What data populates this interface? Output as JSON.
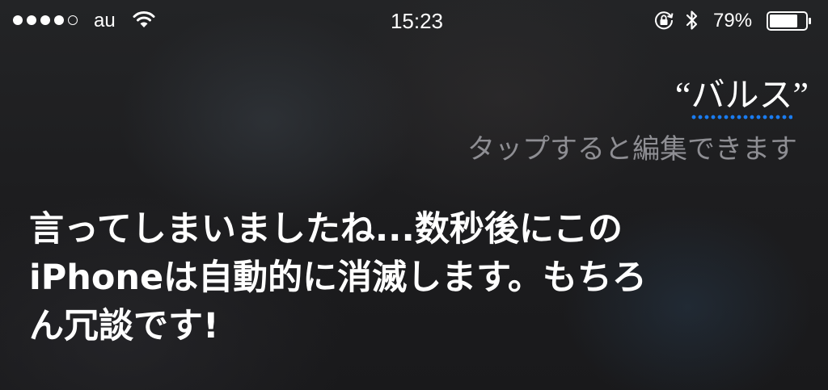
{
  "status_bar": {
    "signal_bars_filled": 4,
    "signal_bars_total": 5,
    "carrier": "au",
    "time": "15:23",
    "battery_percent": "79%",
    "battery_level": 0.79,
    "icons": [
      "wifi-icon",
      "rotation-lock-icon",
      "bluetooth-icon",
      "battery-icon"
    ]
  },
  "siri": {
    "query_open_quote": "“",
    "query_text": "バルス",
    "query_close_quote": "”",
    "edit_hint": "タップすると編集できます",
    "response_lines": [
      "言ってしまいましたね...数秒後にこの",
      "iPhoneは自動的に消滅します。もちろ",
      "ん冗談です!"
    ],
    "underline_color": "#1a7cf0"
  },
  "colors": {
    "text": "#ffffff",
    "hint": "#8e8e93"
  }
}
